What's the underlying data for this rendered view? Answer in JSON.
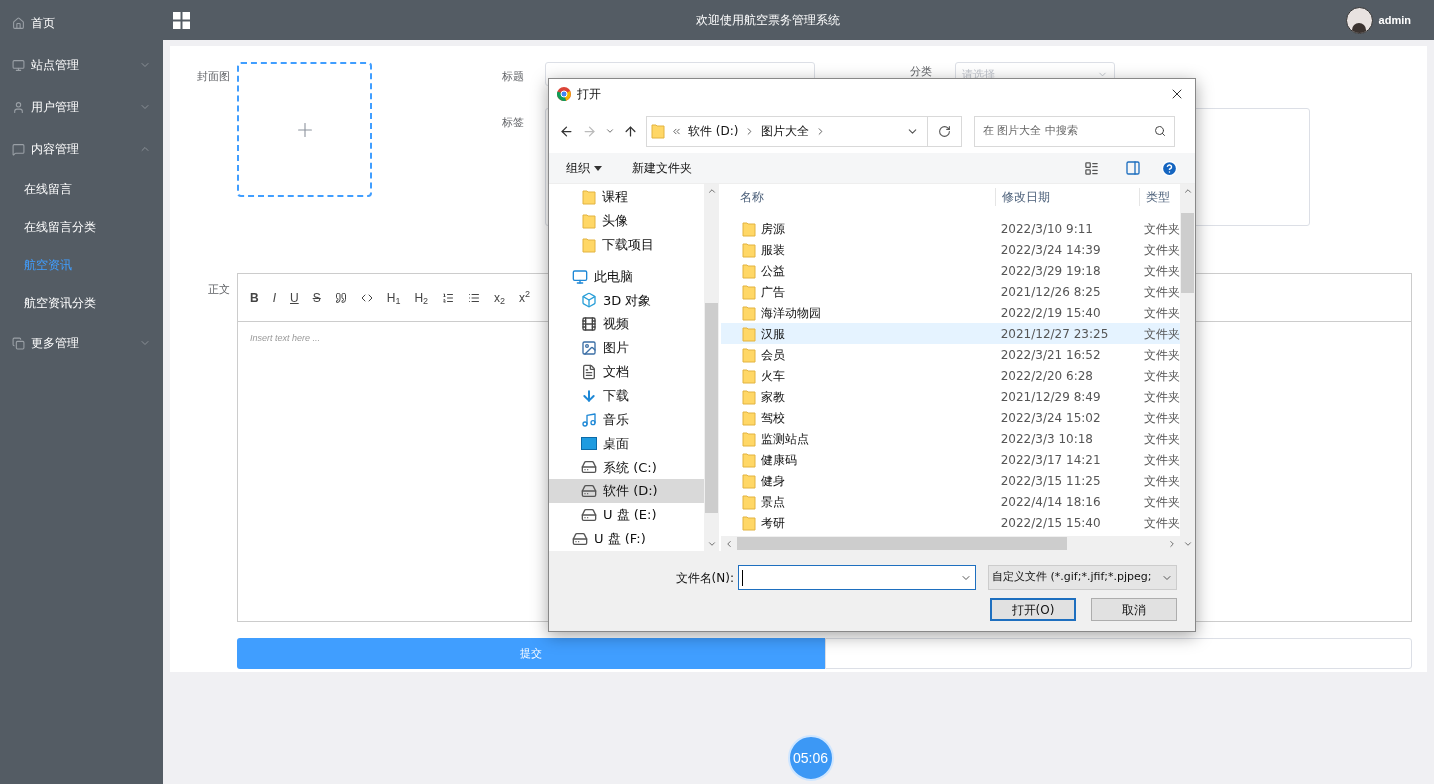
{
  "sidebar": {
    "items": [
      {
        "label": "首页"
      },
      {
        "label": "站点管理",
        "expanded": false
      },
      {
        "label": "用户管理",
        "expanded": false
      },
      {
        "label": "内容管理",
        "expanded": true,
        "children": [
          {
            "label": "在线留言",
            "selected": false
          },
          {
            "label": "在线留言分类",
            "selected": false
          },
          {
            "label": "航空资讯",
            "selected": true
          },
          {
            "label": "航空资讯分类",
            "selected": false
          }
        ]
      },
      {
        "label": "更多管理",
        "expanded": false
      }
    ]
  },
  "header": {
    "title": "欢迎使用航空票务管理系统",
    "user": "admin"
  },
  "form": {
    "cover_label": "封面图",
    "title_label": "标题",
    "category_label": "分类",
    "category_placeholder": "请选择",
    "tags_label": "标签",
    "body_label": "正文",
    "toolbar": [
      {
        "kind": "text",
        "label": "B"
      },
      {
        "kind": "text",
        "label": "I"
      },
      {
        "kind": "text",
        "label": "U"
      },
      {
        "kind": "text",
        "label": "S"
      },
      {
        "kind": "icon"
      },
      {
        "kind": "icon"
      },
      {
        "kind": "text",
        "label": "H$_{1}$"
      },
      {
        "kind": "text",
        "label": "H$_{2}$"
      },
      {
        "kind": "icon"
      },
      {
        "kind": "icon"
      },
      {
        "kind": "text",
        "label": "x$_{2}$"
      },
      {
        "kind": "text",
        "label": "x$^{2}$"
      }
    ],
    "editor_placeholder": "Insert text here ...",
    "submit": "提交"
  },
  "dialog": {
    "title": "打开",
    "path": [
      "软件 (D:)",
      "图片大全"
    ],
    "search_placeholder": "在 图片大全 中搜索",
    "commands": [
      "组织",
      "新建文件夹"
    ],
    "quick": [
      {
        "label": "课程",
        "selected": false
      },
      {
        "label": "头像",
        "selected": false
      },
      {
        "label": "下载项目",
        "selected": false
      }
    ],
    "tree": [
      {
        "label": "此电脑",
        "selected": false,
        "children": [
          {
            "label": "3D 对象",
            "selected": false
          },
          {
            "label": "视频",
            "selected": false
          },
          {
            "label": "图片",
            "selected": false
          },
          {
            "label": "文档",
            "selected": false
          },
          {
            "label": "下载",
            "selected": false
          },
          {
            "label": "音乐",
            "selected": false
          },
          {
            "label": "桌面",
            "selected": false
          },
          {
            "label": "系统 (C:)",
            "selected": false
          },
          {
            "label": "软件 (D:)",
            "selected": true
          },
          {
            "label": "U 盘 (E:)",
            "selected": false
          }
        ]
      },
      {
        "label": "U 盘 (F:)",
        "selected": false
      }
    ],
    "columns": [
      "名称",
      "修改日期",
      "类型"
    ],
    "rows": [
      {
        "name": "房源",
        "date": "2022/3/10 9:11",
        "type": "文件夹",
        "selected": false
      },
      {
        "name": "服装",
        "date": "2022/3/24 14:39",
        "type": "文件夹",
        "selected": false
      },
      {
        "name": "公益",
        "date": "2022/3/29 19:18",
        "type": "文件夹",
        "selected": false
      },
      {
        "name": "广告",
        "date": "2021/12/26 8:25",
        "type": "文件夹",
        "selected": false
      },
      {
        "name": "海洋动物园",
        "date": "2022/2/19 15:40",
        "type": "文件夹",
        "selected": false
      },
      {
        "name": "汉服",
        "date": "2021/12/27 23:25",
        "type": "文件夹",
        "selected": true
      },
      {
        "name": "会员",
        "date": "2022/3/21 16:52",
        "type": "文件夹",
        "selected": false
      },
      {
        "name": "火车",
        "date": "2022/2/20 6:28",
        "type": "文件夹",
        "selected": false
      },
      {
        "name": "家教",
        "date": "2021/12/29 8:49",
        "type": "文件夹",
        "selected": false
      },
      {
        "name": "驾校",
        "date": "2022/3/24 15:02",
        "type": "文件夹",
        "selected": false
      },
      {
        "name": "监测站点",
        "date": "2022/3/3 10:18",
        "type": "文件夹",
        "selected": false
      },
      {
        "name": "健康码",
        "date": "2022/3/17 14:21",
        "type": "文件夹",
        "selected": false
      },
      {
        "name": "健身",
        "date": "2022/3/15 11:25",
        "type": "文件夹",
        "selected": false
      },
      {
        "name": "景点",
        "date": "2022/4/14 18:16",
        "type": "文件夹",
        "selected": false
      },
      {
        "name": "考研",
        "date": "2022/2/15 15:40",
        "type": "文件夹",
        "selected": false
      }
    ],
    "filename_label": "文件名(N):",
    "filetype": "自定义文件 (*.gif;*.jfif;*.pjpeg;",
    "open": "打开(O)",
    "cancel": "取消"
  },
  "timer": "05:06"
}
